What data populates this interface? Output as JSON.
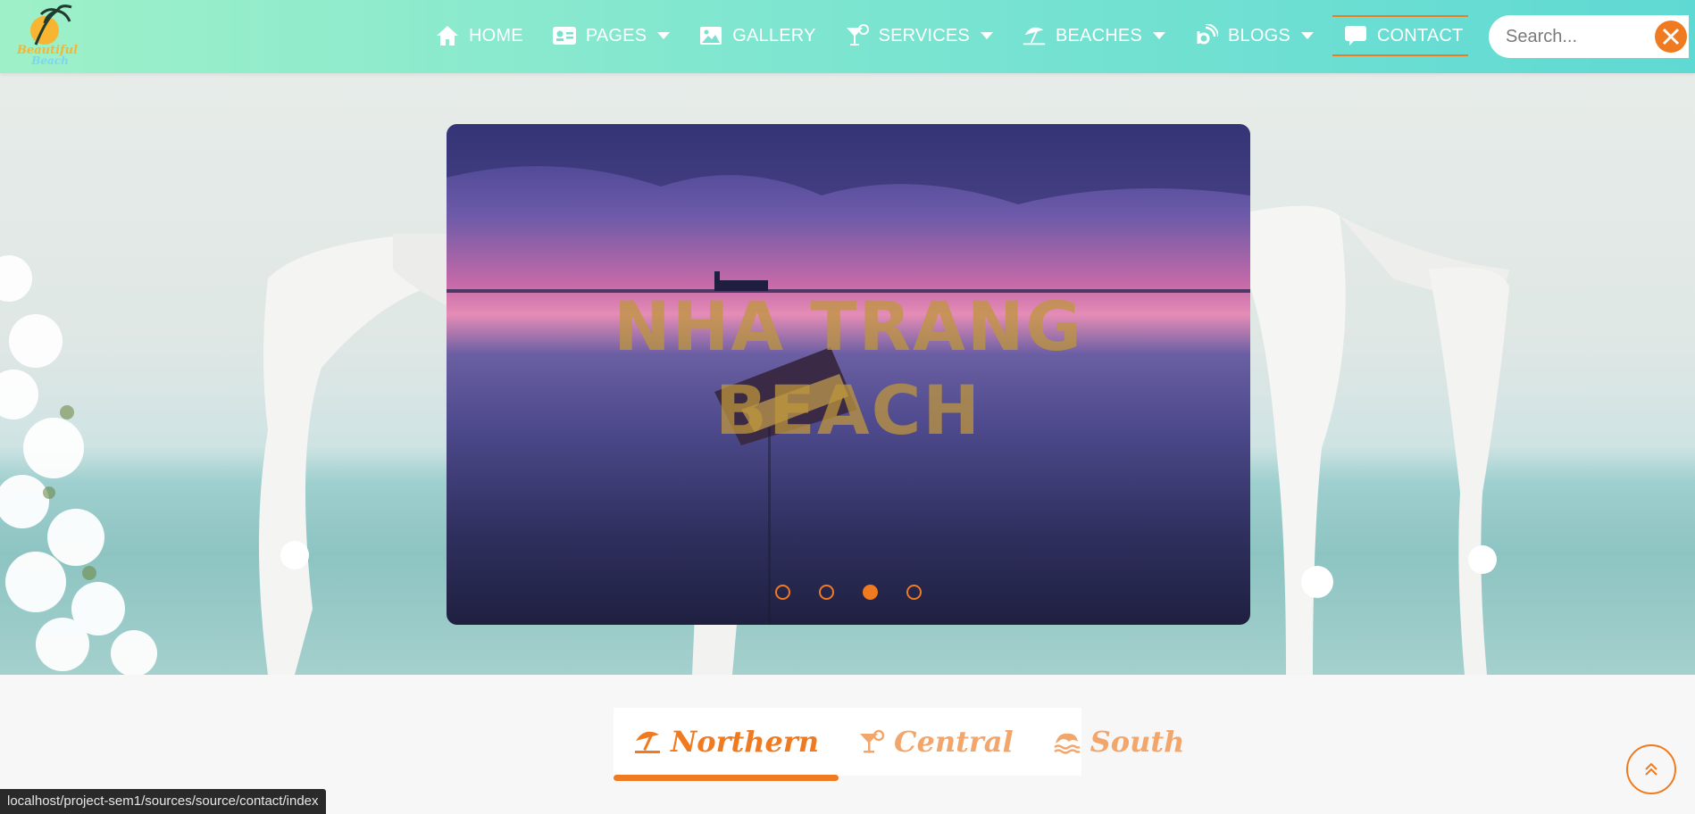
{
  "logo": {
    "alt": "Beautiful Beach",
    "line1": "Beautiful",
    "line2": "Beach"
  },
  "nav": {
    "items": [
      {
        "label": "HOME",
        "icon": "home-icon",
        "caret": false
      },
      {
        "label": "PAGES",
        "icon": "id-card-icon",
        "caret": true
      },
      {
        "label": "GALLERY",
        "icon": "image-icon",
        "caret": false
      },
      {
        "label": "SERVICES",
        "icon": "cocktail-icon",
        "caret": true
      },
      {
        "label": "BEACHES",
        "icon": "umbrella-beach-icon",
        "caret": true
      },
      {
        "label": "BLOGS",
        "icon": "blog-icon",
        "caret": true
      },
      {
        "label": "CONTACT",
        "icon": "comment-icon",
        "caret": false,
        "active": true
      }
    ]
  },
  "search": {
    "placeholder": "Search...",
    "button_icon": "close-icon"
  },
  "hero": {
    "slide_title_line1": "NHA TRANG",
    "slide_title_line2": "BEACH",
    "dots": [
      false,
      false,
      true,
      false
    ]
  },
  "tabs": [
    {
      "label": "Northern",
      "icon": "umbrella-beach-icon",
      "active": true
    },
    {
      "label": "Central",
      "icon": "cocktail-icon",
      "active": false
    },
    {
      "label": "South",
      "icon": "water-icon",
      "active": false
    }
  ],
  "status_url": "localhost/project-sem1/sources/source/contact/index",
  "colors": {
    "accent": "#f07a1f",
    "header_start": "#9ef0c8",
    "header_end": "#5fd9d3"
  }
}
